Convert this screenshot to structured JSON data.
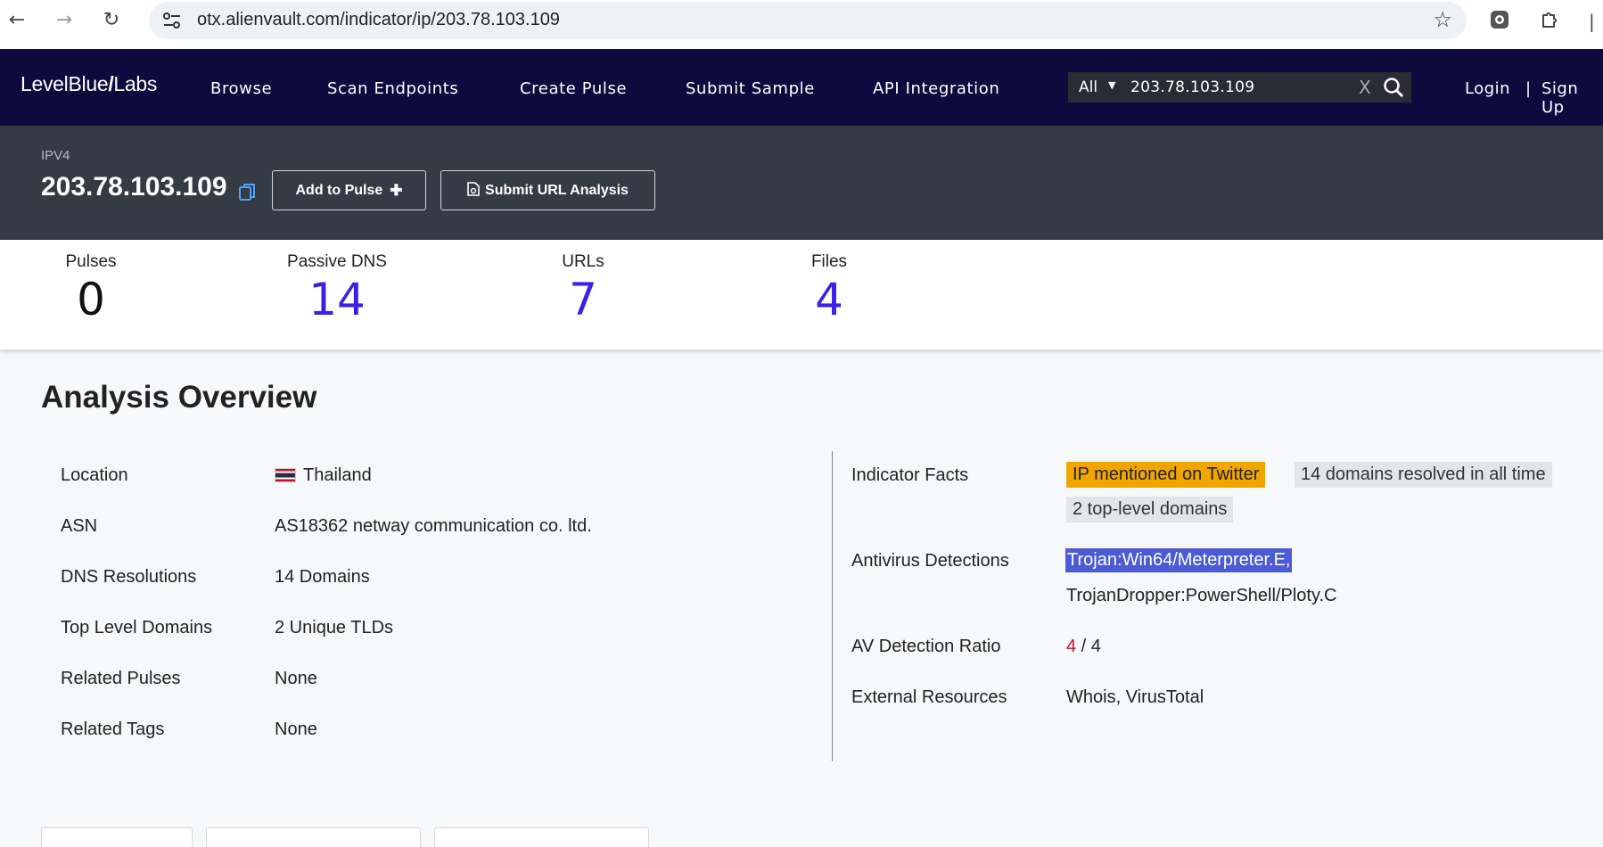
{
  "browser": {
    "url": "otx.alienvault.com/indicator/ip/203.78.103.109"
  },
  "navbar": {
    "logo_left": "LevelBlue",
    "logo_slash": "/",
    "logo_right": "Labs",
    "items": [
      {
        "label": "Browse"
      },
      {
        "label": "Scan Endpoints"
      },
      {
        "label": "Create Pulse"
      },
      {
        "label": "Submit Sample"
      },
      {
        "label": "API Integration"
      }
    ],
    "search": {
      "scope": "All",
      "query": "203.78.103.109",
      "clear": "X"
    },
    "login": "Login",
    "separator": "|",
    "signup": "Sign Up"
  },
  "indicator": {
    "type": "IPV4",
    "value": "203.78.103.109",
    "add_to_pulse": "Add to Pulse",
    "submit_url_analysis": "Submit URL Analysis"
  },
  "stats": [
    {
      "label": "Pulses",
      "value": "0"
    },
    {
      "label": "Passive DNS",
      "value": "14"
    },
    {
      "label": "URLs",
      "value": "7"
    },
    {
      "label": "Files",
      "value": "4"
    }
  ],
  "overview": {
    "title": "Analysis Overview",
    "left": [
      {
        "label": "Location",
        "value": "Thailand"
      },
      {
        "label": "ASN",
        "value": "AS18362 netway communication co. ltd."
      },
      {
        "label": "DNS Resolutions",
        "value": "14 Domains"
      },
      {
        "label": "Top Level Domains",
        "value": "2 Unique TLDs"
      },
      {
        "label": "Related Pulses",
        "value": "None"
      },
      {
        "label": "Related Tags",
        "value": "None"
      }
    ],
    "right": {
      "indicator_facts_label": "Indicator Facts",
      "facts": [
        "IP mentioned on Twitter",
        "14 domains resolved in all time",
        "2 top-level domains"
      ],
      "antivirus_label": "Antivirus Detections",
      "detections": [
        "Trojan:Win64/Meterpreter.E,",
        "TrojanDropper:PowerShell/Ploty.C"
      ],
      "ratio_label": "AV Detection Ratio",
      "ratio_detected": "4",
      "ratio_total": " / 4",
      "external_label": "External Resources",
      "external_links": "Whois, VirusTotal"
    }
  },
  "colors": {
    "navbar_bg": "#0e0a3d",
    "header_bg": "#353b44",
    "accent": "#3d1de8",
    "fact_highlight": "#f0a500",
    "selection": "#4b5bd6",
    "ratio_red": "#c8102e"
  }
}
